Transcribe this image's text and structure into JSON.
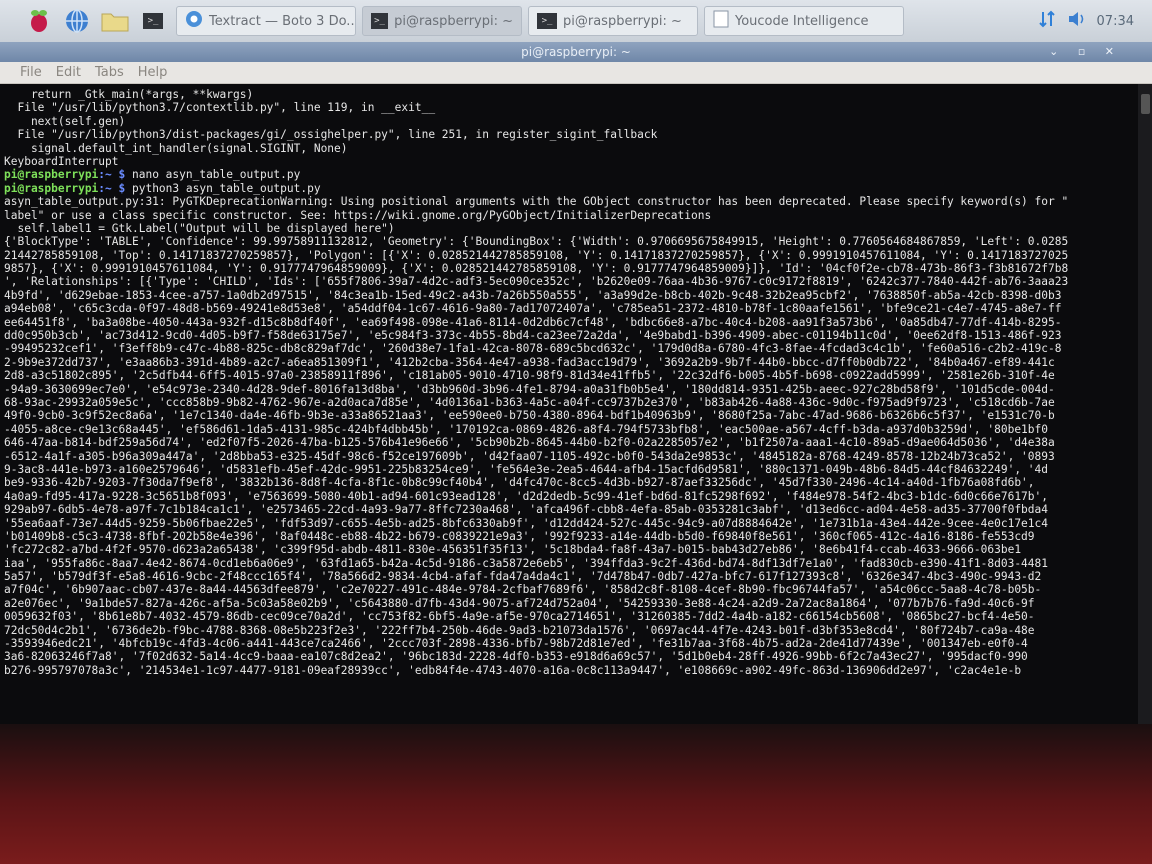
{
  "taskbar": {
    "tasks": [
      {
        "label": "Textract — Boto 3 Do...",
        "kind": "browser"
      },
      {
        "label": "pi@raspberrypi: ~",
        "kind": "terminal"
      },
      {
        "label": "pi@raspberrypi: ~",
        "kind": "terminal"
      },
      {
        "label": "Youcode Intelligence",
        "kind": "document"
      }
    ],
    "clock": "07:34",
    "icons": [
      "raspberry-menu-icon",
      "globe-icon",
      "folder-icon",
      "terminal-icon",
      "chromium-icon",
      "network-icon",
      "volume-icon"
    ]
  },
  "window": {
    "title": "pi@raspberrypi: ~",
    "controls": "⌄ ▫ ✕",
    "menu": [
      "File",
      "Edit",
      "Tabs",
      "Help"
    ]
  },
  "terminal": {
    "lines": [
      "    return _Gtk_main(*args, **kwargs)",
      "  File \"/usr/lib/python3.7/contextlib.py\", line 119, in __exit__",
      "    next(self.gen)",
      "  File \"/usr/lib/python3/dist-packages/gi/_ossighelper.py\", line 251, in register_sigint_fallback",
      "    signal.default_int_handler(signal.SIGINT, None)",
      "KeyboardInterrupt",
      "",
      "",
      "asyn_table_output.py:31: PyGTKDeprecationWarning: Using positional arguments with the GObject constructor has been deprecated. Please specify keyword(s) for \"",
      "label\" or use a class specific constructor. See: https://wiki.gnome.org/PyGObject/InitializerDeprecations",
      "  self.label1 = Gtk.Label(\"Output will be displayed here\")",
      "{'BlockType': 'TABLE', 'Confidence': 99.99758911132812, 'Geometry': {'BoundingBox': {'Width': 0.9706695675849915, 'Height': 0.7760564684867859, 'Left': 0.0285",
      "21442785859108, 'Top': 0.14171837270259857}, 'Polygon': [{'X': 0.028521442785859108, 'Y': 0.14171837270259857}, {'X': 0.9991910457611084, 'Y': 0.1417183727025",
      "9857}, {'X': 0.9991910457611084, 'Y': 0.9177747964859009}, {'X': 0.028521442785859108, 'Y': 0.9177747964859009}]}, 'Id': '04cf0f2e-cb78-473b-86f3-f3b81672f7b8",
      "', 'Relationships': [{'Type': 'CHILD', 'Ids': ['655f7806-39a7-4d2c-adf3-5ec090ce352c', 'b2620e09-76aa-4b36-9767-c0c9172f8819', '6242c377-7840-442f-ab76-3aaa23",
      "4b9fd', 'd629ebae-1853-4cee-a757-1a0db2d97515', '84c3ea1b-15ed-49c2-a43b-7a26b550a555', 'a3a99d2e-b8cb-402b-9c48-32b2ea95cbf2', '7638850f-ab5a-42cb-8398-d0b3",
      "a94eb08', 'c65c3cda-0f97-48d8-b569-49241e8d53e8', 'a54ddf04-1c67-4616-9a80-7ad17072407a', 'c785ea51-2372-4810-b78f-1c80aafe1561', 'bfe9ce21-c4e7-4745-a8e7-ff",
      "ee64451f8', 'ba3a08be-4050-443a-932f-d15c8b8df40f', 'ea69f498-098e-41a6-8114-0d2db6c7cf48', 'bdbc66e8-a7bc-40c4-b208-aa91f3a573b6', '0a85db47-77df-414b-8295-",
      "dd0c950b3cb', 'ac73d412-9cd0-4d05-b9f7-f58de63175e7', 'e5c984f3-373c-4b55-8bd4-ca23ee72a2da', '4e9babd1-b396-4909-abec-c01194b11c0d', '0ee62df8-1513-486f-923",
      "-99495232cef1', 'f3eff8b9-c47c-4b88-825c-db8c829af7dc', '260d38e7-1fa1-42ca-8078-689c5bcd632c', '179d0d8a-6780-4fc3-8fae-4fcdad3c4c1b', 'fe60a516-c2b2-419c-8",
      "2-9b9e372dd737', 'e3aa86b3-391d-4b89-a2c7-a6ea851309f1', '412b2cba-3564-4e47-a938-fad3acc19d79', '3692a2b9-9b7f-44b0-bbcc-d7ff0b0db722', '84b0a467-ef89-441c",
      "2d8-a3c51802c895', '2c5dfb44-6ff5-4015-97a0-23858911f896', 'c181ab05-9010-4710-98f9-81d34e41ffb5', '22c32df6-b005-4b5f-b698-c0922add5999', '2581e26b-310f-4e",
      "-94a9-3630699ec7e0', 'e54c973e-2340-4d28-9def-8016fa13d8ba', 'd3bb960d-3b96-4fe1-8794-a0a31fb0b5e4', '180dd814-9351-425b-aeec-927c28bd58f9', '101d5cde-004d-",
      "68-93ac-29932a059e5c', 'ccc858b9-9b82-4762-967e-a2d0aca7d85e', '4d0136a1-b363-4a5c-a04f-cc9737b2e370', 'b83ab426-4a88-436c-9d0c-f975ad9f9723', 'c518cd6b-7ae",
      "49f0-9cb0-3c9f52ec8a6a', '1e7c1340-da4e-46fb-9b3e-a33a86521aa3', 'ee590ee0-b750-4380-8964-bdf1b40963b9', '8680f25a-7abc-47ad-9686-b6326b6c5f37', 'e1531c70-b",
      "-4055-a8ce-c9e13c68a445', 'ef586d61-1da5-4131-985c-424bf4dbb45b', '170192ca-0869-4826-a8f4-794f5733bfb8', 'eac500ae-a567-4cff-b3da-a937d0b3259d', '80be1bf0",
      "646-47aa-b814-bdf259a56d74', 'ed2f07f5-2026-47ba-b125-576b41e96e66', '5cb90b2b-8645-44b0-b2f0-02a2285057e2', 'b1f2507a-aaa1-4c10-89a5-d9ae064d5036', 'd4e38a",
      "-6512-4a1f-a305-b96a309a447a', '2d8bba53-e325-45df-98c6-f52ce197609b', 'd42faa07-1105-492c-b0f0-543da2e9853c', '4845182a-8768-4249-8578-12b24b73ca52', '0893",
      "9-3ac8-441e-b973-a160e2579646', 'd5831efb-45ef-42dc-9951-225b83254ce9', 'fe564e3e-2ea5-4644-afb4-15acfd6d9581', '880c1371-049b-48b6-84d5-44cf84632249', '4d",
      "be9-9336-42b7-9203-7f30da7f9ef8', '3832b136-8d8f-4cfa-8f1c-0b8c99cf40b4', 'd4fc470c-8cc5-4d3b-b927-87aef33256dc', '45d7f330-2496-4c14-a40d-1fb76a08fd6b',",
      "4a0a9-fd95-417a-9228-3c5651b8f093', 'e7563699-5080-40b1-ad94-601c93ead128', 'd2d2dedb-5c99-41ef-bd6d-81fc5298f692', 'f484e978-54f2-4bc3-b1dc-6d0c66e7617b',",
      "929ab97-6db5-4e78-a97f-7c1b184ca1c1', 'e2573465-22cd-4a93-9a77-8ffc7230a468', 'afca496f-cbb8-4efa-85ab-0353281c3abf', 'd13ed6cc-ad04-4e58-ad35-37700f0fbda4",
      "'55ea6aaf-73e7-44d5-9259-5b06fbae22e5', 'fdf53d97-c655-4e5b-ad25-8bfc6330ab9f', 'd12dd424-527c-445c-94c9-a07d8884642e', '1e731b1a-43e4-442e-9cee-4e0c17e1c4",
      "'b01409b8-c5c3-4738-8fbf-202b58e4e396', '8af0448c-eb88-4b22-b679-c0839221e9a3', '992f9233-a14e-44db-b5d0-f69840f8e561', '360cf065-412c-4a16-8186-fe553cd9",
      "'fc272c82-a7bd-4f2f-9570-d623a2a65438', 'c399f95d-abdb-4811-830e-456351f35f13', '5c18bda4-fa8f-43a7-b015-bab43d27eb86', '8e6b41f4-ccab-4633-9666-063be1",
      "iaa', '955fa86c-8aa7-4e42-8674-0cd1eb6a06e9', '63fd1a65-b42a-4c5d-9186-c3a5872e6eb5', '394ffda3-9c2f-436d-bd74-8df13df7e1a0', 'fad830cb-e390-41f1-8d03-4481",
      "5a57', 'b579df3f-e5a8-4616-9cbc-2f48ccc165f4', '78a566d2-9834-4cb4-afaf-fda47a4da4c1', '7d478b47-0db7-427a-bfc7-617f127393c8', '6326e347-4bc3-490c-9943-d2",
      "a7f04c', '6b907aac-cb07-437e-8a44-44563dfee879', 'c2e70227-491c-484e-9784-2cfbaf7689f6', '858d2c8f-8108-4cef-8b90-fbc96744fa57', 'a54c06cc-5aa8-4c78-b05b-",
      "a2e076ec', '9a1bde57-827a-426c-af5a-5c03a58e02b9', 'c5643880-d7fb-43d4-9075-af724d752a04', '54259330-3e88-4c24-a2d9-2a72ac8a1864', '077b7b76-fa9d-40c6-9f",
      "0059632f03', '8b61e8b7-4032-4579-86db-cec09ce70a2d', 'cc753f82-6bf5-4a9e-af5e-970ca2714651', '31260385-7dd2-4a4b-a182-c66154cb5608', '0865bc27-bcf4-4e50-",
      "72dc50d4c2b1', '6736de2b-f9bc-4788-8368-08e5b223f2e3', '222ff7b4-250b-46de-9ad3-b21073da1576', '0697ac44-4f7e-4243-b01f-d3bf353e8cd4', '80f724b7-ca9a-48e",
      "-3593946edc21', '4bfcb19c-4fd3-4c06-a441-443ce7ca2466', '2ccc703f-2898-4336-bfb7-98b72d81e7ed', 'fe31b7aa-3f68-4b75-ad2a-2de41d77439e', '001347eb-e0f0-4",
      "3a6-82063246f7a8', '7f02d632-5a14-4cc9-baaa-ea107c8d2ea2', '96bc183d-2228-4df0-b353-e918d6a69c57', '5d1b0eb4-28ff-4926-99bb-6f2c7a43ec27', '995dacf0-990",
      "b276-995797078a3c', '214534e1-1c97-4477-9181-09eaf28939cc', 'edb84f4e-4743-4070-a16a-0c8c113a9447', 'e108669c-a902-49fc-863d-136906dd2e97', 'c2ac4e1e-b"
    ],
    "prompts": [
      {
        "index": 6,
        "user": "pi@raspberrypi",
        "path": ":~ $",
        "command": " nano asyn_table_output.py"
      },
      {
        "index": 7,
        "user": "pi@raspberrypi",
        "path": ":~ $",
        "command": " python3 asyn_table_output.py"
      }
    ]
  }
}
